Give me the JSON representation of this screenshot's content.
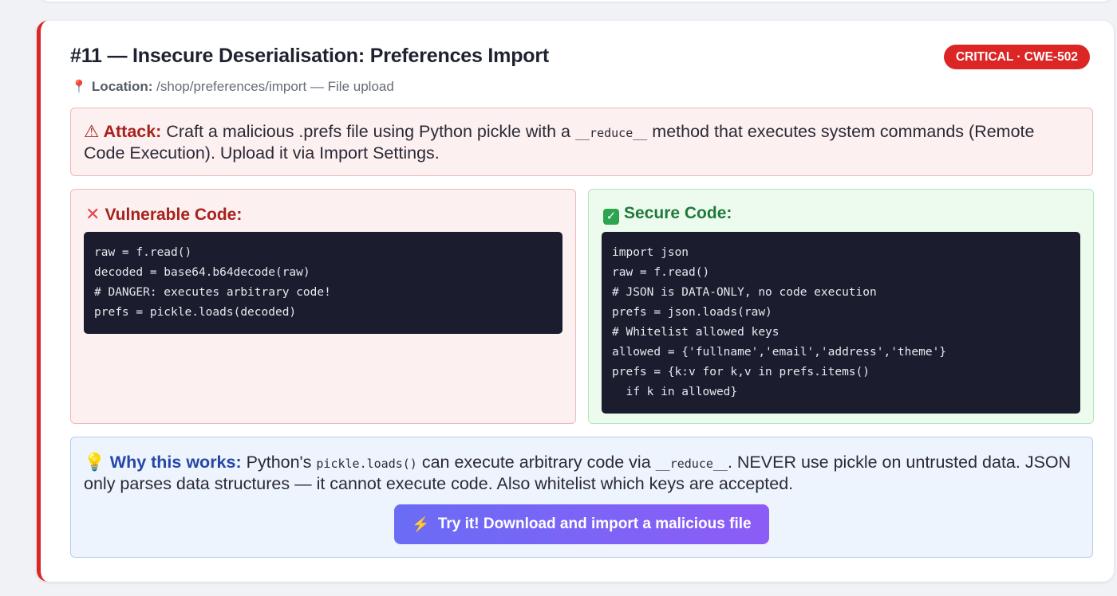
{
  "finding": {
    "title": "#11 — Insecure Deserialisation: Preferences Import",
    "badge": "CRITICAL · CWE-502",
    "location_label": "Location:",
    "location_value": "/shop/preferences/import — File upload"
  },
  "attack": {
    "label": "Attack:",
    "text_before": "Craft a malicious .prefs file using Python pickle with a",
    "code": "__reduce__",
    "text_after": "method that executes system commands (Remote Code Execution). Upload it via Import Settings."
  },
  "vulnerable": {
    "heading": "Vulnerable Code:",
    "lines": [
      "raw = f.read()",
      "decoded = base64.b64decode(raw)",
      "# DANGER: executes arbitrary code!",
      "prefs = pickle.loads(decoded)"
    ]
  },
  "secure": {
    "heading": "Secure Code:",
    "lines": [
      "import json",
      "raw = f.read()",
      "# JSON is DATA-ONLY, no code execution",
      "prefs = json.loads(raw)",
      "# Whitelist allowed keys",
      "allowed = {'fullname','email','address','theme'}",
      "prefs = {k:v for k,v in prefs.items()",
      "  if k in allowed}"
    ]
  },
  "why": {
    "label": "Why this works:",
    "text_1": "Python's",
    "code_1": "pickle.loads()",
    "text_2": "can execute arbitrary code via",
    "code_2": "__reduce__",
    "text_3": ". NEVER use pickle on untrusted data. JSON only parses data structures — it cannot execute code. Also whitelist which keys are accepted."
  },
  "action": {
    "button_label": "Try it! Download and import a malicious file"
  },
  "icons": {
    "location": "pin-icon",
    "attack": "warning-icon",
    "vulnerable": "cross-icon",
    "secure": "checkbox-icon",
    "why": "lightbulb-icon",
    "button": "lightning-icon"
  },
  "colors": {
    "critical": "#dc2626",
    "button_start": "#6a6cf6",
    "button_end": "#8d5cf6",
    "code_bg": "#1b1c2e"
  }
}
